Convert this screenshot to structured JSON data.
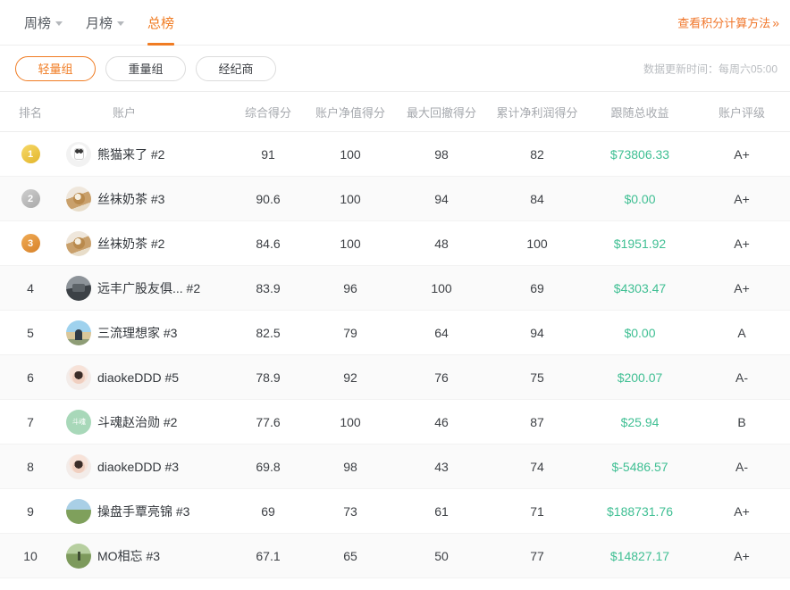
{
  "topbar": {
    "tabs": [
      {
        "label": "周榜",
        "active": false,
        "caret": true
      },
      {
        "label": "月榜",
        "active": false,
        "caret": true
      },
      {
        "label": "总榜",
        "active": true,
        "caret": false
      }
    ],
    "score_link": {
      "label": "查看积分计算方法",
      "chevrons": "»"
    },
    "accent_color": "#f07c23"
  },
  "filterbar": {
    "pills": [
      {
        "label": "轻量组",
        "active": true
      },
      {
        "label": "重量组",
        "active": false
      },
      {
        "label": "经纪商",
        "active": false
      }
    ],
    "update_time": "数据更新时间：每周六05:00"
  },
  "table": {
    "columns": [
      "排名",
      "账户",
      "综合得分",
      "账户净值得分",
      "最大回撤得分",
      "累计净利润得分",
      "跟随总收益",
      "账户评级"
    ],
    "money_color": "#3fbf93",
    "rows": [
      {
        "rank": "1",
        "medal": "gold",
        "avatar": "av-panda",
        "avatar_text": "",
        "account": "熊猫来了 #2",
        "total_score": "91",
        "net_score": "100",
        "drawdown_score": "98",
        "profit_score": "82",
        "follow_income": "$73806.33",
        "rating": "A+"
      },
      {
        "rank": "2",
        "medal": "silver",
        "avatar": "av-milktea",
        "avatar_text": "",
        "account": "丝袜奶茶 #3",
        "total_score": "90.6",
        "net_score": "100",
        "drawdown_score": "94",
        "profit_score": "84",
        "follow_income": "$0.00",
        "rating": "A+"
      },
      {
        "rank": "3",
        "medal": "bronze",
        "avatar": "av-milktea",
        "avatar_text": "",
        "account": "丝袜奶茶 #2",
        "total_score": "84.6",
        "net_score": "100",
        "drawdown_score": "48",
        "profit_score": "100",
        "follow_income": "$1951.92",
        "rating": "A+"
      },
      {
        "rank": "4",
        "medal": "",
        "avatar": "av-club",
        "avatar_text": "",
        "account": "远丰广股友俱... #2",
        "total_score": "83.9",
        "net_score": "96",
        "drawdown_score": "100",
        "profit_score": "69",
        "follow_income": "$4303.47",
        "rating": "A+"
      },
      {
        "rank": "5",
        "medal": "",
        "avatar": "av-ideal",
        "avatar_text": "",
        "account": "三流理想家 #3",
        "total_score": "82.5",
        "net_score": "79",
        "drawdown_score": "64",
        "profit_score": "94",
        "follow_income": "$0.00",
        "rating": "A"
      },
      {
        "rank": "6",
        "medal": "",
        "avatar": "av-girl",
        "avatar_text": "",
        "account": "diaokeDDD #5",
        "total_score": "78.9",
        "net_score": "92",
        "drawdown_score": "76",
        "profit_score": "75",
        "follow_income": "$200.07",
        "rating": "A-"
      },
      {
        "rank": "7",
        "medal": "",
        "avatar": "av-douhun",
        "avatar_text": "斗魂",
        "account": "斗魂赵治勋 #2",
        "total_score": "77.6",
        "net_score": "100",
        "drawdown_score": "46",
        "profit_score": "87",
        "follow_income": "$25.94",
        "rating": "B"
      },
      {
        "rank": "8",
        "medal": "",
        "avatar": "av-girl",
        "avatar_text": "",
        "account": "diaokeDDD #3",
        "total_score": "69.8",
        "net_score": "98",
        "drawdown_score": "43",
        "profit_score": "74",
        "follow_income": "$-5486.57",
        "rating": "A-"
      },
      {
        "rank": "9",
        "medal": "",
        "avatar": "av-land",
        "avatar_text": "",
        "account": "操盘手覃亮锦 #3",
        "total_score": "69",
        "net_score": "73",
        "drawdown_score": "61",
        "profit_score": "71",
        "follow_income": "$188731.76",
        "rating": "A+"
      },
      {
        "rank": "10",
        "medal": "",
        "avatar": "av-field",
        "avatar_text": "",
        "account": "MO相忘 #3",
        "total_score": "67.1",
        "net_score": "65",
        "drawdown_score": "50",
        "profit_score": "77",
        "follow_income": "$14827.17",
        "rating": "A+"
      }
    ]
  }
}
